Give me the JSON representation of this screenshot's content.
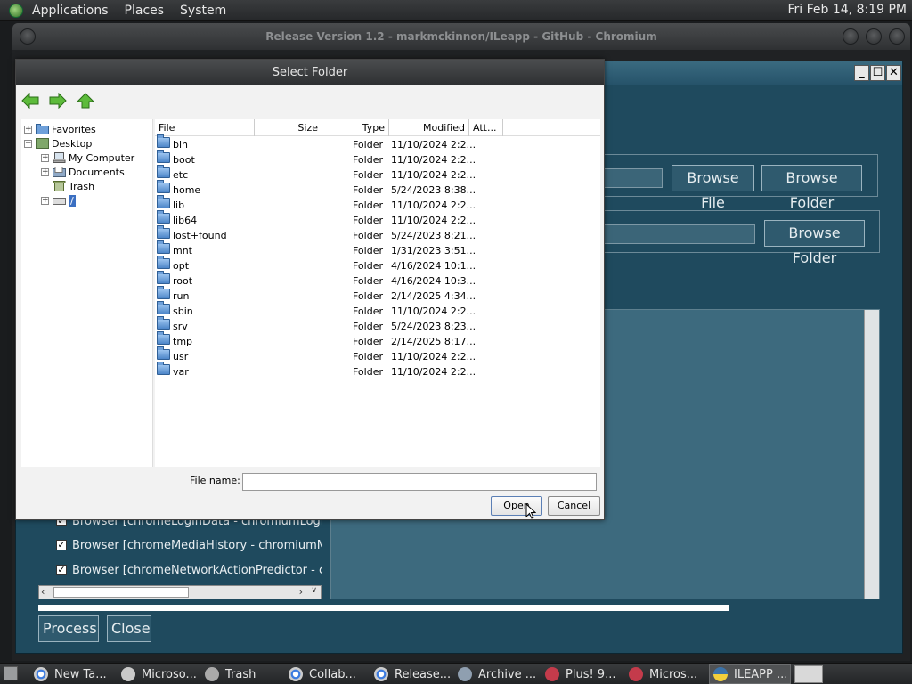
{
  "top_panel": {
    "menus": [
      "Applications",
      "Places",
      "System"
    ],
    "clock": "Fri Feb 14,  8:19 PM"
  },
  "browser": {
    "title": "Release Version 1.2 - markmckinnon/ILeapp - GitHub - Chromium"
  },
  "app": {
    "browse_file_label": "Browse File",
    "browse_folder_label": "Browse Folder",
    "browse_folder_2_label": "Browse Folder",
    "modules": [
      "Browser [chromeLoginData - chromiumLogin",
      "Browser [chromeMediaHistory - chromiumMe",
      "Browser [chromeNetworkActionPredictor - ch"
    ],
    "process_label": "Process",
    "close_label": "Close",
    "progress": 0.78
  },
  "dialog": {
    "title": "Select Folder",
    "tree": [
      {
        "label": "Favorites",
        "expander": "+"
      },
      {
        "label": "Desktop",
        "expander": "−"
      },
      {
        "label": "My Computer",
        "expander": "+"
      },
      {
        "label": "Documents",
        "expander": "+"
      },
      {
        "label": "Trash",
        "expander": ""
      },
      {
        "label": "/",
        "expander": "+"
      }
    ],
    "columns": [
      "File",
      "Size",
      "Type",
      "Modified",
      "Att..."
    ],
    "files": [
      {
        "name": "bin",
        "type": "Folder",
        "modified": "11/10/2024 2:2..."
      },
      {
        "name": "boot",
        "type": "Folder",
        "modified": "11/10/2024 2:2..."
      },
      {
        "name": "etc",
        "type": "Folder",
        "modified": "11/10/2024 2:2..."
      },
      {
        "name": "home",
        "type": "Folder",
        "modified": "5/24/2023 8:38..."
      },
      {
        "name": "lib",
        "type": "Folder",
        "modified": "11/10/2024 2:2..."
      },
      {
        "name": "lib64",
        "type": "Folder",
        "modified": "11/10/2024 2:2..."
      },
      {
        "name": "lost+found",
        "type": "Folder",
        "modified": "5/24/2023 8:21..."
      },
      {
        "name": "mnt",
        "type": "Folder",
        "modified": "1/31/2023 3:51..."
      },
      {
        "name": "opt",
        "type": "Folder",
        "modified": "4/16/2024 10:1..."
      },
      {
        "name": "root",
        "type": "Folder",
        "modified": "4/16/2024 10:3..."
      },
      {
        "name": "run",
        "type": "Folder",
        "modified": "2/14/2025 4:34..."
      },
      {
        "name": "sbin",
        "type": "Folder",
        "modified": "11/10/2024 2:2..."
      },
      {
        "name": "srv",
        "type": "Folder",
        "modified": "5/24/2023 8:23..."
      },
      {
        "name": "tmp",
        "type": "Folder",
        "modified": "2/14/2025 8:17..."
      },
      {
        "name": "usr",
        "type": "Folder",
        "modified": "11/10/2024 2:2..."
      },
      {
        "name": "var",
        "type": "Folder",
        "modified": "11/10/2024 2:2..."
      }
    ],
    "filename_label": "File name:",
    "filename_value": "",
    "open_label": "Open",
    "cancel_label": "Cancel"
  },
  "taskbar": {
    "items": [
      {
        "label": "New Ta...",
        "icon": "chrome-icon"
      },
      {
        "label": "Microso...",
        "icon": "file-manager-icon"
      },
      {
        "label": "Trash",
        "icon": "trash-icon"
      },
      {
        "label": "Collab...",
        "icon": "chrome-icon"
      },
      {
        "label": "Release...",
        "icon": "chrome-icon"
      },
      {
        "label": "Archive ...",
        "icon": "archive-icon"
      },
      {
        "label": "Plus! 9...",
        "icon": "app-icon"
      },
      {
        "label": "Micros...",
        "icon": "app-icon"
      },
      {
        "label": "ILEAPP ...",
        "icon": "python-icon"
      }
    ]
  },
  "colors": {
    "app_bg": "#1f4a5e",
    "panel_bg": "#2e3032",
    "dialog_bg": "#f2f2f2",
    "folder_blue": "#4d86c9"
  }
}
